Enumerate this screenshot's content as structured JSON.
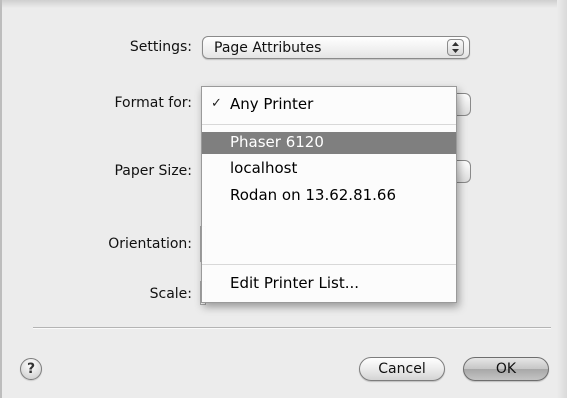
{
  "settings": {
    "label": "Settings:",
    "value": "Page Attributes"
  },
  "format_for": {
    "label": "Format for:",
    "menu": {
      "items": [
        {
          "label": "Any Printer",
          "checked": true
        },
        {
          "label": "Phaser 6120",
          "highlighted": true
        },
        {
          "label": "localhost"
        },
        {
          "label": "Rodan on 13.62.81.66"
        }
      ],
      "edit_item": "Edit Printer List..."
    }
  },
  "paper_size": {
    "label": "Paper Size:"
  },
  "orientation": {
    "label": "Orientation:"
  },
  "scale": {
    "label": "Scale:"
  },
  "buttons": {
    "help": "?",
    "cancel": "Cancel",
    "ok": "OK"
  },
  "icons": {
    "check": "✓",
    "stepper": "up-down-arrows"
  },
  "colors": {
    "highlight": "#7f7f7f",
    "background": "#ececec"
  }
}
